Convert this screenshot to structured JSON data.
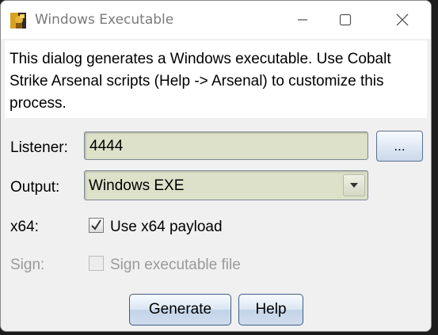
{
  "window": {
    "title": "Windows Executable",
    "icon": "cobalt-strike-app-icon",
    "controls": [
      "minimize-icon",
      "maximize-icon",
      "close-icon"
    ]
  },
  "description": "This dialog generates a Windows executable. Use Cobalt Strike Arsenal scripts (Help -> Arsenal) to customize this process.",
  "form": {
    "listener_label": "Listener:",
    "listener_value": "4444",
    "browse_label": "...",
    "output_label": "Output:",
    "output_value": "Windows EXE",
    "x64_label": "x64:",
    "x64_checkbox_label": "Use x64 payload",
    "x64_checked": true,
    "sign_label": "Sign:",
    "sign_checkbox_label": "Sign executable file",
    "sign_checked": false,
    "sign_enabled": false
  },
  "buttons": {
    "generate": "Generate",
    "help": "Help"
  },
  "colors": {
    "field_bg": "#dde1c9",
    "button_border": "#3f5d84",
    "disabled_text": "#9a9a9a"
  }
}
